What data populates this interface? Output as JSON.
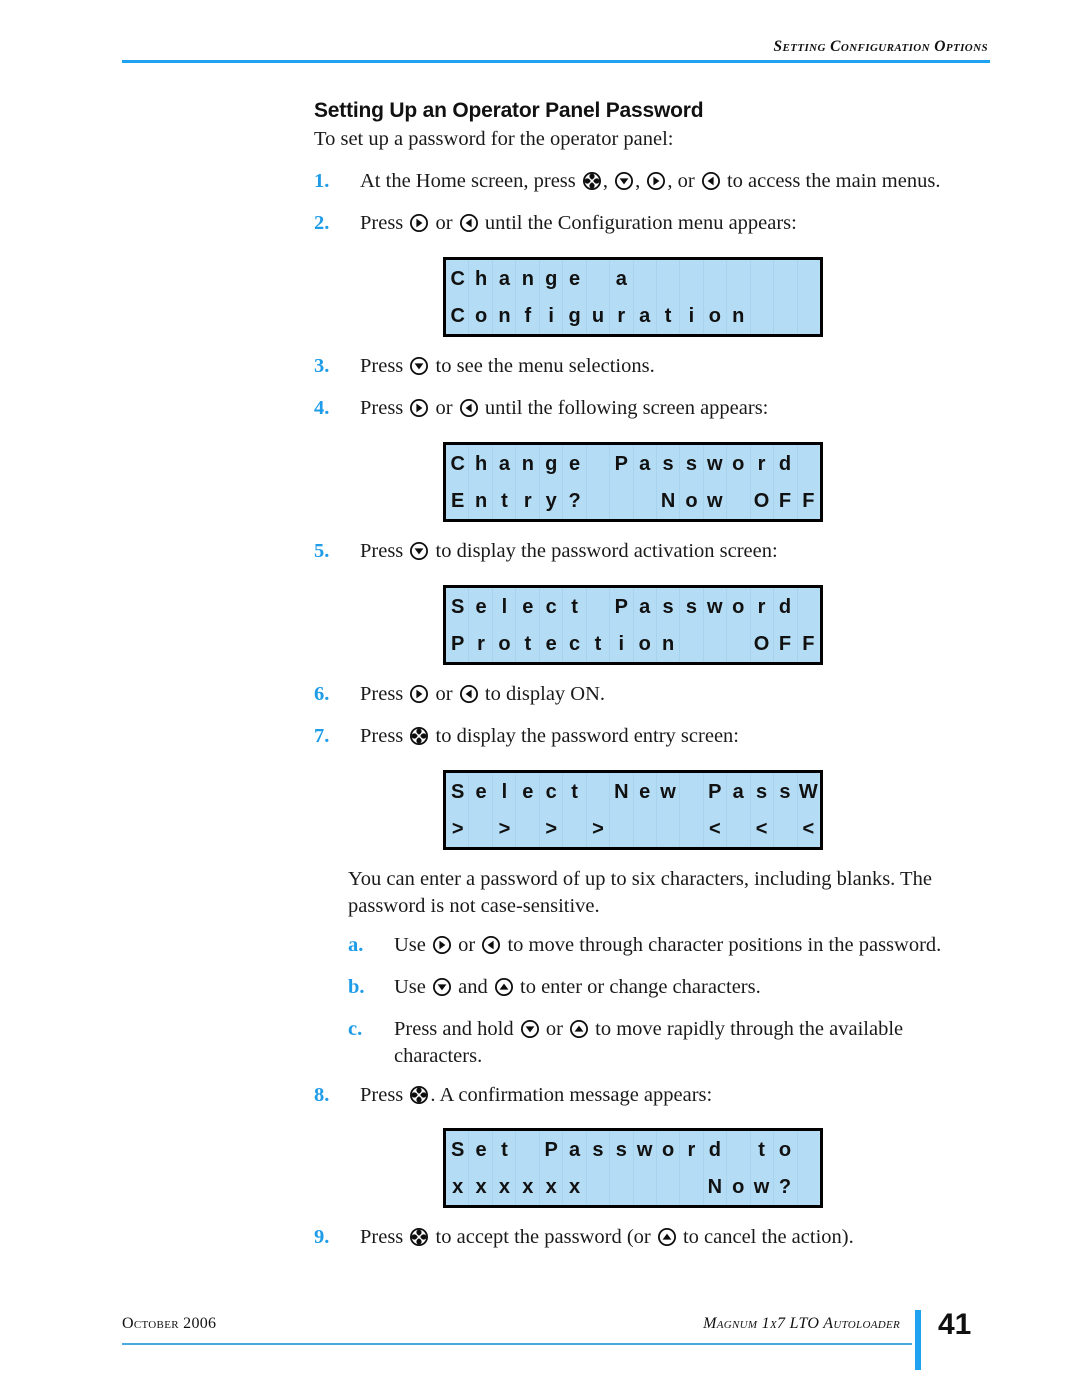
{
  "header": {
    "title": "Setting Configuration Options"
  },
  "page": {
    "heading": "Setting Up an Operator Panel Password",
    "intro": "To set up a password for the operator panel:"
  },
  "steps": [
    {
      "num": "1.",
      "parts": [
        {
          "t": "text",
          "v": "At the Home screen, press "
        },
        {
          "t": "icon",
          "v": "select-key-icon"
        },
        {
          "t": "text",
          "v": ", "
        },
        {
          "t": "icon",
          "v": "down-arrow-key-icon"
        },
        {
          "t": "text",
          "v": ", "
        },
        {
          "t": "icon",
          "v": "right-arrow-key-icon"
        },
        {
          "t": "text",
          "v": ", or "
        },
        {
          "t": "icon",
          "v": "left-arrow-key-icon"
        },
        {
          "t": "text",
          "v": " to access the main menus."
        }
      ]
    },
    {
      "num": "2.",
      "parts": [
        {
          "t": "text",
          "v": "Press "
        },
        {
          "t": "icon",
          "v": "right-arrow-key-icon"
        },
        {
          "t": "text",
          "v": " or "
        },
        {
          "t": "icon",
          "v": "left-arrow-key-icon"
        },
        {
          "t": "text",
          "v": " until the Configuration menu appears:"
        }
      ]
    },
    {
      "num": "3.",
      "parts": [
        {
          "t": "text",
          "v": "Press "
        },
        {
          "t": "icon",
          "v": "down-arrow-key-icon"
        },
        {
          "t": "text",
          "v": " to see the menu selections."
        }
      ]
    },
    {
      "num": "4.",
      "parts": [
        {
          "t": "text",
          "v": "Press "
        },
        {
          "t": "icon",
          "v": "right-arrow-key-icon"
        },
        {
          "t": "text",
          "v": " or "
        },
        {
          "t": "icon",
          "v": "left-arrow-key-icon"
        },
        {
          "t": "text",
          "v": " until the following screen appears:"
        }
      ]
    },
    {
      "num": "5.",
      "parts": [
        {
          "t": "text",
          "v": "Press "
        },
        {
          "t": "icon",
          "v": "down-arrow-key-icon"
        },
        {
          "t": "text",
          "v": " to display the password activation screen:"
        }
      ]
    },
    {
      "num": "6.",
      "parts": [
        {
          "t": "text",
          "v": "Press "
        },
        {
          "t": "icon",
          "v": "right-arrow-key-icon"
        },
        {
          "t": "text",
          "v": " or "
        },
        {
          "t": "icon",
          "v": "left-arrow-key-icon"
        },
        {
          "t": "text",
          "v": " to display ON."
        }
      ]
    },
    {
      "num": "7.",
      "parts": [
        {
          "t": "text",
          "v": "Press "
        },
        {
          "t": "icon",
          "v": "select-key-icon"
        },
        {
          "t": "text",
          "v": " to display the password entry screen:"
        }
      ]
    },
    {
      "num": "8.",
      "parts": [
        {
          "t": "text",
          "v": "Press "
        },
        {
          "t": "icon",
          "v": "select-key-icon"
        },
        {
          "t": "text",
          "v": ". A confirmation message appears:"
        }
      ]
    },
    {
      "num": "9.",
      "parts": [
        {
          "t": "text",
          "v": "Press "
        },
        {
          "t": "icon",
          "v": "select-key-icon"
        },
        {
          "t": "text",
          "v": " to accept the password (or "
        },
        {
          "t": "icon",
          "v": "up-arrow-key-icon"
        },
        {
          "t": "text",
          "v": " to cancel the action)."
        }
      ]
    }
  ],
  "note": "You can enter a password of up to six characters, including blanks. The password is not case-sensitive.",
  "substeps": [
    {
      "num": "a.",
      "parts": [
        {
          "t": "text",
          "v": "Use "
        },
        {
          "t": "icon",
          "v": "right-arrow-key-icon"
        },
        {
          "t": "text",
          "v": " or "
        },
        {
          "t": "icon",
          "v": "left-arrow-key-icon"
        },
        {
          "t": "text",
          "v": " to move through character positions in the password."
        }
      ]
    },
    {
      "num": "b.",
      "parts": [
        {
          "t": "text",
          "v": "Use "
        },
        {
          "t": "icon",
          "v": "down-arrow-key-icon"
        },
        {
          "t": "text",
          "v": " and "
        },
        {
          "t": "icon",
          "v": "up-arrow-key-icon"
        },
        {
          "t": "text",
          "v": " to enter or change characters."
        }
      ]
    },
    {
      "num": "c.",
      "parts": [
        {
          "t": "text",
          "v": "Press and hold "
        },
        {
          "t": "icon",
          "v": "down-arrow-key-icon"
        },
        {
          "t": "text",
          "v": " or "
        },
        {
          "t": "icon",
          "v": "up-arrow-key-icon"
        },
        {
          "t": "text",
          "v": " to move rapidly through the available characters."
        }
      ]
    }
  ],
  "lcd_screens": [
    {
      "id": "lcd-change-a-configuration",
      "line1": "Change a        ",
      "line2": "Configuration   "
    },
    {
      "id": "lcd-change-password-entry",
      "line1": "Change Password ",
      "line2": "Entry?   Now OFF"
    },
    {
      "id": "lcd-select-password-protection",
      "line1": "Select Password ",
      "line2": "Protection   OFF"
    },
    {
      "id": "lcd-select-new-password",
      "line1": "Select New PassW",
      "line2": "> > > >    < < < < <"
    },
    {
      "id": "lcd-set-password-to",
      "line1": "Set Password to ",
      "line2": "xxxxxx     Now? "
    }
  ],
  "footer": {
    "left": "October 2006",
    "right": "Magnum 1x7 LTO Autoloader",
    "page_number": "41"
  },
  "colors": {
    "accent_blue": "#1fa2f0",
    "lcd_fill": "#b4dcf4",
    "lcd_border": "#000000"
  }
}
